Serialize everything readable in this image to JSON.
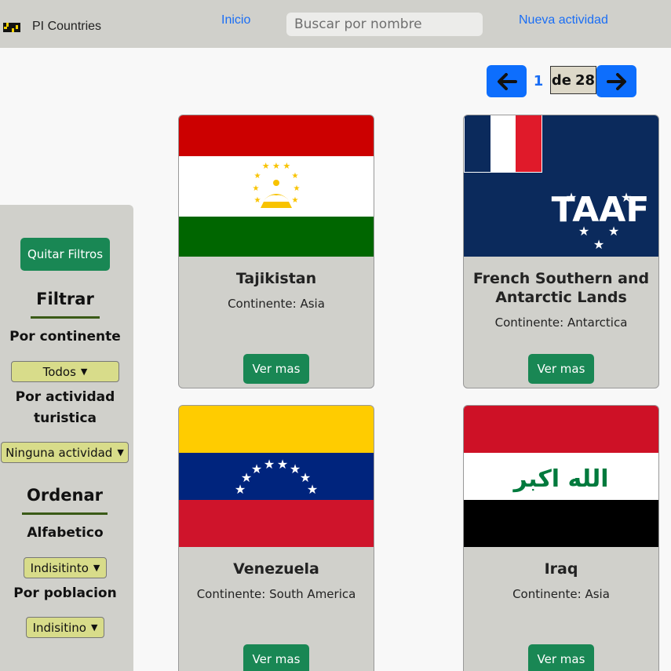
{
  "navbar": {
    "brand": "PI Countries",
    "links": {
      "inicio": "Inicio",
      "nueva_actividad": "Nueva actividad"
    },
    "search": {
      "placeholder": "Buscar por nombre",
      "value": ""
    }
  },
  "pagination": {
    "current": "1",
    "de": "de",
    "total": "28"
  },
  "sidebar": {
    "clear_filters": "Quitar Filtros",
    "filter_heading": "Filtrar",
    "by_continent_label": "Por continente",
    "continent_selected": "Todos",
    "by_activity_label": "Por actividad turistica",
    "activity_selected": "Ninguna actividad",
    "sort_heading": "Ordenar",
    "alpha_label": "Alfabetico",
    "alpha_selected": "Indisitinto",
    "population_label": "Por poblacion",
    "population_selected": "Indisitino"
  },
  "cards": [
    {
      "name": "Tajikistan",
      "continent": "Continente: Asia",
      "button": "Ver mas",
      "flag": "tajikistan-flag"
    },
    {
      "name": "French Southern and Antarctic Lands",
      "continent": "Continente: Antarctica",
      "button": "Ver mas",
      "flag": "french-southern-lands-flag"
    },
    {
      "name": "Venezuela",
      "continent": "Continente: South America",
      "button": "Ver mas",
      "flag": "venezuela-flag"
    },
    {
      "name": "Iraq",
      "continent": "Continente: Asia",
      "button": "Ver mas",
      "flag": "iraq-flag"
    }
  ],
  "iraq_flag_text": "الله اكبر",
  "taaf_flag_text": "TAAF",
  "colors": {
    "navbar_bg": "#d0d0cb",
    "link": "#1a6ef5",
    "primary_button": "#0d6efd",
    "green_button": "#198754",
    "select_bg": "#d8dc8a"
  }
}
